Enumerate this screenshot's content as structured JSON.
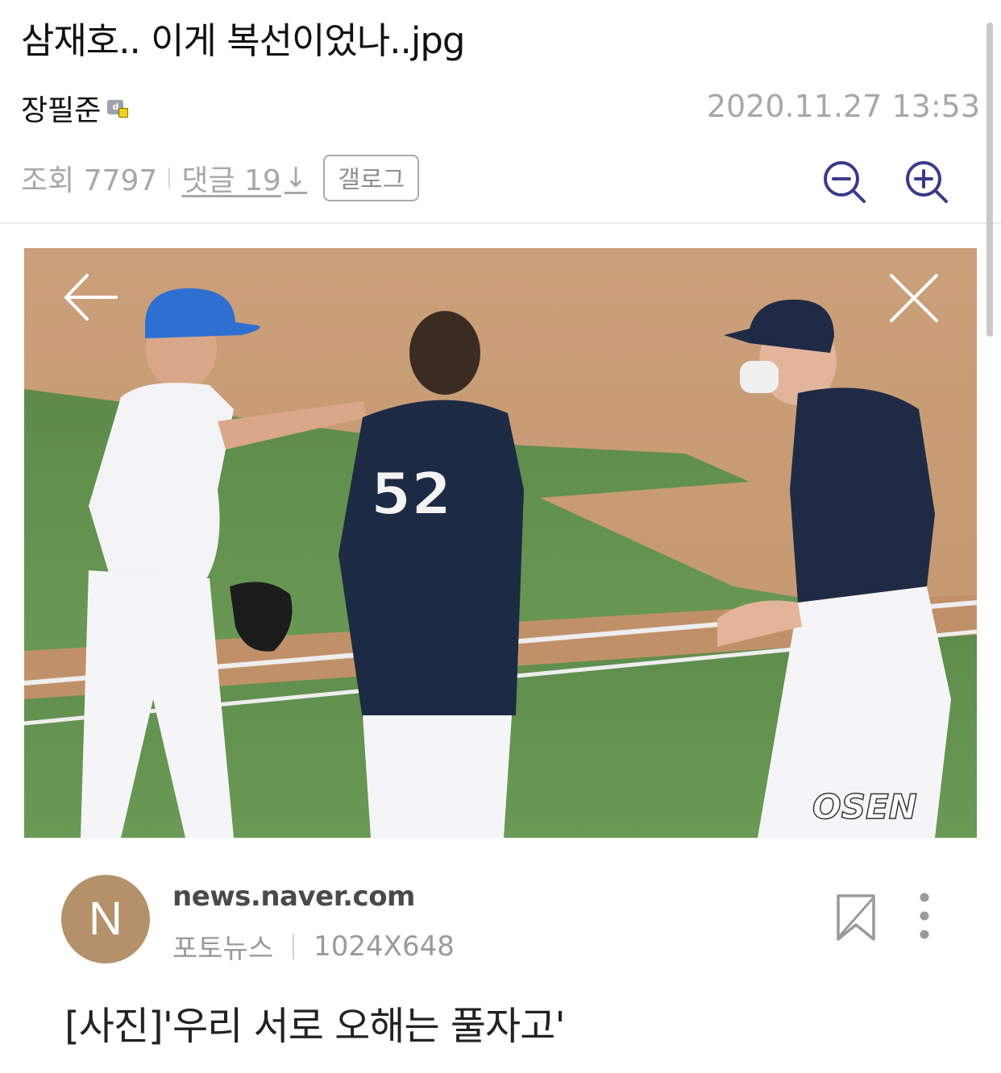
{
  "post": {
    "title": "삼재호.. 이게 복선이었나..jpg",
    "author": "장필준",
    "author_badge": "level-badge-icon",
    "datetime": "2020.11.27 13:53",
    "views_text": "조회 7797",
    "comments_text": "댓글 19",
    "comments_arrow": "↓",
    "gallog_label": "갤로그"
  },
  "toolbar": {
    "zoom_out_icon": "zoom-out-icon",
    "zoom_in_icon": "zoom-in-icon"
  },
  "image_viewer": {
    "jersey_number": "52",
    "watermark": "OSEN",
    "back_icon": "arrow-left-icon",
    "close_icon": "close-icon"
  },
  "source_card": {
    "avatar_letter": "N",
    "domain": "news.naver.com",
    "category": "포토뉴스",
    "dimensions": "1024X648",
    "caption": "[사진]'우리 서로 오해는 풀자고'",
    "bookmark_icon": "bookmark-icon",
    "more_icon": "more-vertical-icon"
  },
  "colors": {
    "accent_icon": "#3a3a8c",
    "muted_text": "#a7a7a7",
    "avatar_bg": "#b4916b"
  }
}
